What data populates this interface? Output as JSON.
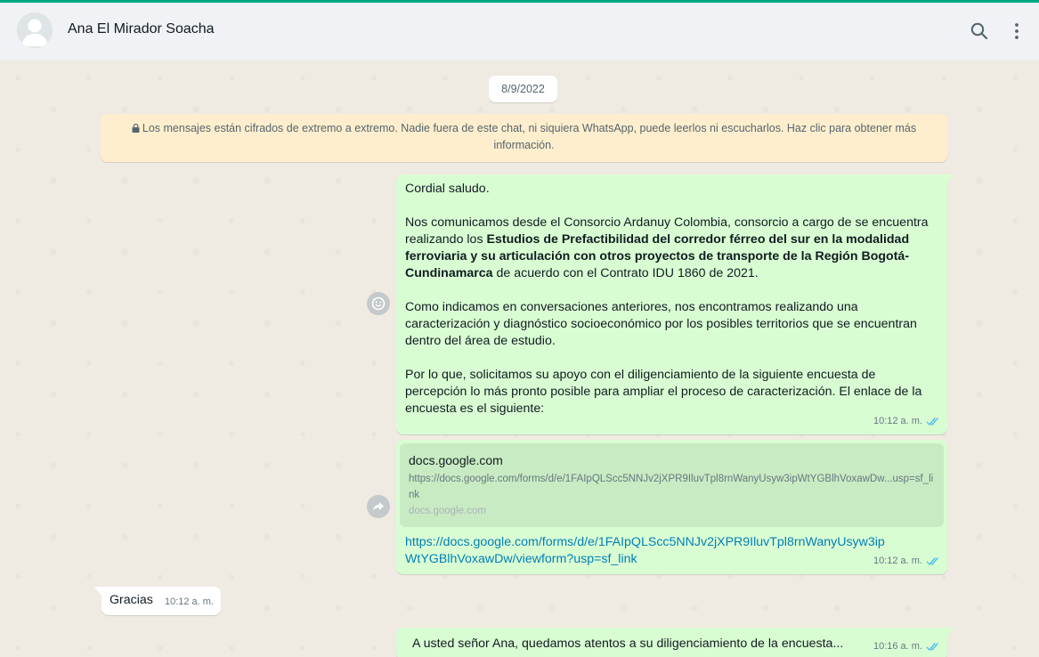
{
  "header": {
    "contact_name": "Ana El Mirador Soacha",
    "avatar_icon": "default-user-avatar-icon",
    "search_icon": "search-icon",
    "menu_icon": "kebab-menu-icon"
  },
  "colors": {
    "accent": "#00a884",
    "outgoing_bubble": "#d9fdd3",
    "incoming_bubble": "#ffffff",
    "notice_bg": "#ffeecd",
    "link": "#027eb5",
    "read_ticks": "#53bdeb",
    "chat_bg": "#efeae2"
  },
  "chat": {
    "date_chip": "8/9/2022",
    "encryption_notice": "Los mensajes están cifrados de extremo a extremo. Nadie fuera de este chat, ni siquiera WhatsApp, puede leerlos ni escucharlos. Haz clic para obtener más información.",
    "messages": [
      {
        "direction": "outgoing",
        "greeting": "Cordial saludo.",
        "p2_before": "Nos comunicamos desde el Consorcio Ardanuy Colombia, consorcio a cargo de se encuentra realizando los ",
        "p2_bold": "Estudios de Prefactibilidad del corredor férreo del sur en la modalidad ferroviaria y su articulación con otros proyectos de transporte de la Región Bogotá-Cundinamarca",
        "p2_after": " de acuerdo con el Contrato IDU 1860 de 2021.",
        "p3": "Como indicamos en conversaciones anteriores, nos encontramos realizando una caracterización y diagnóstico socioeconómico por los posibles territorios que se encuentran dentro del área de estudio.",
        "p4": "Por lo que, solicitamos su apoyo con el diligenciamiento de la siguiente encuesta de percepción lo más pronto posible para ampliar el proceso de caracterización. El enlace de la encuesta es el siguiente:",
        "time": "10:12 a. m.",
        "side_icon": "emoji-reaction-icon",
        "status_icon": "double-check-read-icon"
      },
      {
        "direction": "outgoing",
        "preview_title": "docs.google.com",
        "preview_description": "https://docs.google.com/forms/d/e/1FAIpQLScc5NNJv2jXPR9IluvTpl8rnWanyUsyw3ipWtYGBlhVoxawDw...usp=sf_link",
        "preview_domain": "docs.google.com",
        "link": "https://docs.google.com/forms/d/e/1FAIpQLScc5NNJv2jXPR9IluvTpl8rnWanyUsyw3ipWtYGBlhVoxawDw/viewform?usp=sf_link",
        "time": "10:12 a. m.",
        "side_icon": "forward-icon",
        "status_icon": "double-check-read-icon"
      },
      {
        "direction": "incoming",
        "text": "Gracias",
        "time": "10:12 a. m."
      },
      {
        "direction": "outgoing",
        "text": "A usted señor Ana, quedamos atentos a su diligenciamiento de la encuesta...",
        "time": "10:16 a. m.",
        "status_icon": "double-check-read-icon"
      }
    ]
  }
}
